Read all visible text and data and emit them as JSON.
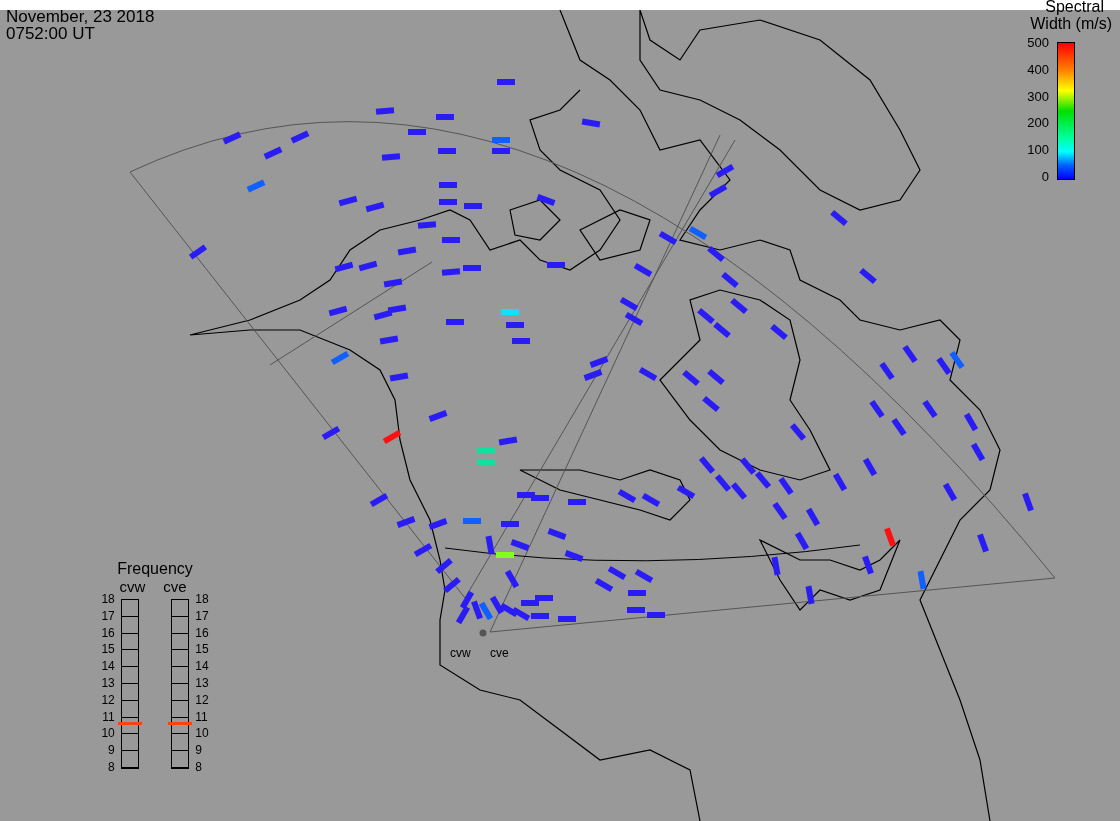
{
  "header": {
    "date": "November, 23 2018",
    "time": "0752:00 UT"
  },
  "color_scale": {
    "title_line_1": "Spectral",
    "title_line_2": "Width (m/s)",
    "ticks": [
      "500",
      "400",
      "300",
      "200",
      "100",
      "0"
    ]
  },
  "map": {
    "radar_labels": [
      "cvw",
      "cve"
    ]
  },
  "frequency": {
    "title": "Frequency",
    "radars": [
      {
        "name": "cvw",
        "level": 0.26,
        "ticks": [
          "18",
          "17",
          "16",
          "15",
          "14",
          "13",
          "12",
          "11",
          "10",
          "9",
          "8"
        ]
      },
      {
        "name": "cve",
        "level": 0.26,
        "ticks": [
          "18",
          "17",
          "16",
          "15",
          "14",
          "13",
          "12",
          "11",
          "10",
          "9",
          "8"
        ]
      }
    ]
  }
}
